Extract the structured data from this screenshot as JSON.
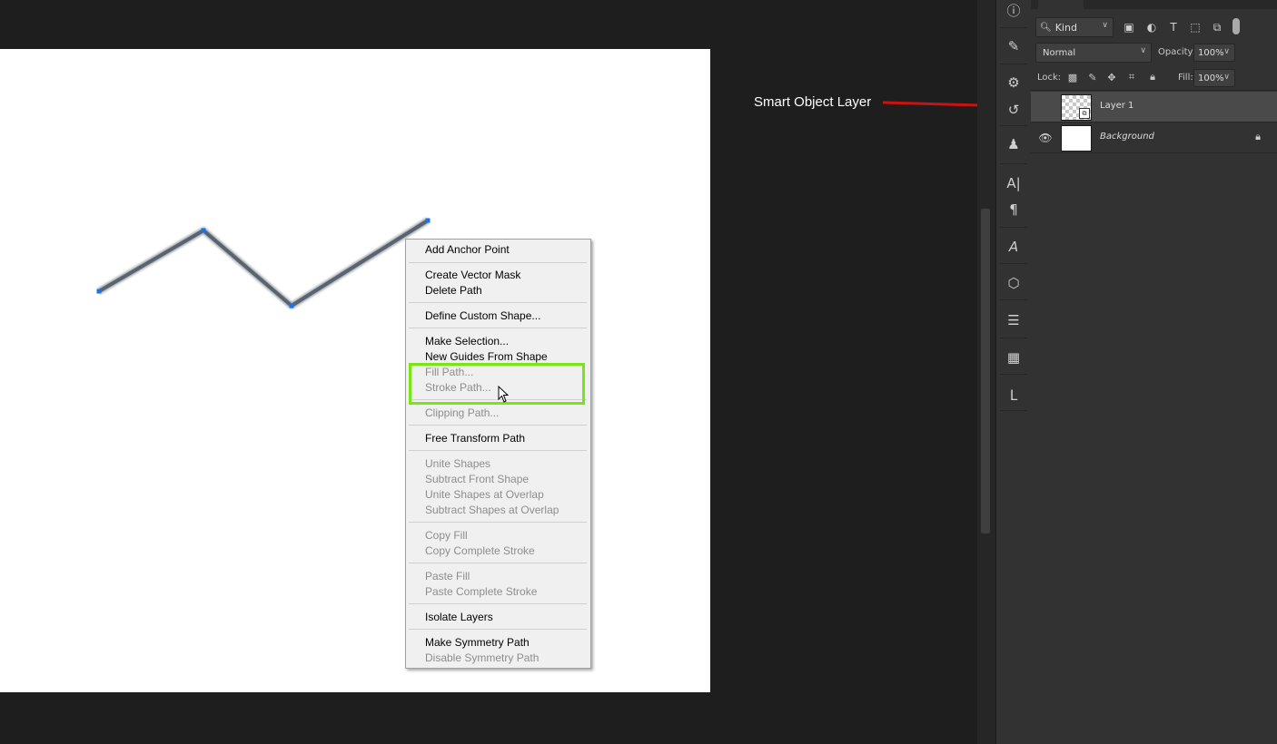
{
  "annotation": {
    "label": "Smart Object Layer",
    "arrow_color": "#cc1111"
  },
  "canvas": {
    "background": "#ffffff",
    "path_color": "#5a6470",
    "anchor_color": "#1a73e8"
  },
  "context_menu": {
    "highlight_color": "#78e615",
    "items": [
      {
        "label": "Add Anchor Point",
        "enabled": true
      },
      {
        "label": "Create Vector Mask",
        "enabled": true
      },
      {
        "label": "Delete Path",
        "enabled": true
      },
      {
        "label": "Define Custom Shape...",
        "enabled": true
      },
      {
        "label": "Make Selection...",
        "enabled": true
      },
      {
        "label": "New Guides From Shape",
        "enabled": true
      },
      {
        "label": "Fill Path...",
        "enabled": false
      },
      {
        "label": "Stroke Path...",
        "enabled": false
      },
      {
        "label": "Clipping Path...",
        "enabled": false
      },
      {
        "label": "Free Transform Path",
        "enabled": true
      },
      {
        "label": "Unite Shapes",
        "enabled": false
      },
      {
        "label": "Subtract Front Shape",
        "enabled": false
      },
      {
        "label": "Unite Shapes at Overlap",
        "enabled": false
      },
      {
        "label": "Subtract Shapes at Overlap",
        "enabled": false
      },
      {
        "label": "Copy Fill",
        "enabled": false
      },
      {
        "label": "Copy Complete Stroke",
        "enabled": false
      },
      {
        "label": "Paste Fill",
        "enabled": false
      },
      {
        "label": "Paste Complete Stroke",
        "enabled": false
      },
      {
        "label": "Isolate Layers",
        "enabled": true
      },
      {
        "label": "Make Symmetry Path",
        "enabled": true
      },
      {
        "label": "Disable Symmetry Path",
        "enabled": false
      }
    ]
  },
  "layers_panel": {
    "filter": {
      "kind_label": "Kind"
    },
    "blend_mode": "Normal",
    "opacity_label": "Opacity:",
    "opacity_value": "100%",
    "lock_label": "Lock:",
    "fill_label": "Fill:",
    "fill_value": "100%",
    "layers": [
      {
        "name": "Layer 1",
        "type": "smart-object",
        "selected": true,
        "visible_eye": false,
        "locked": false
      },
      {
        "name": "Background",
        "type": "background",
        "selected": false,
        "visible_eye": true,
        "locked": true
      }
    ]
  }
}
